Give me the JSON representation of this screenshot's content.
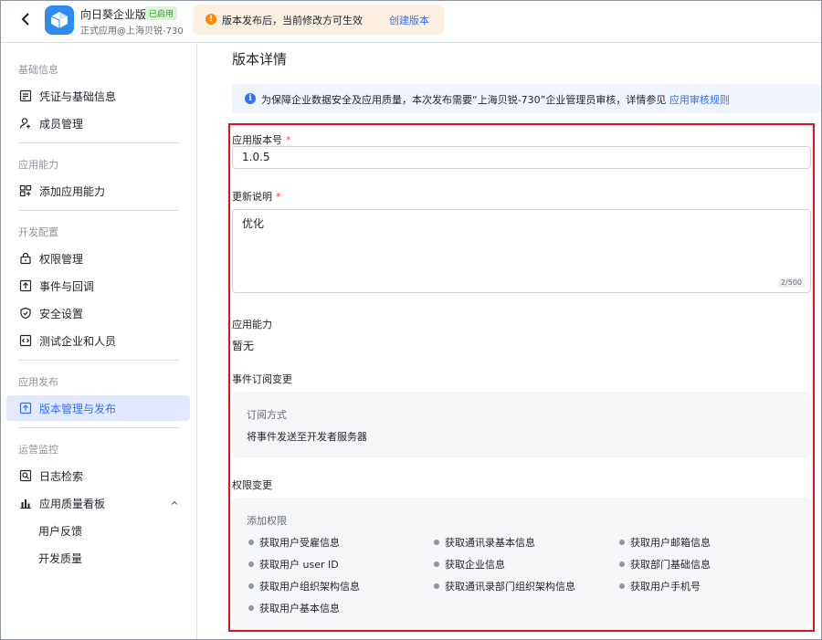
{
  "header": {
    "app_name": "向日葵企业版",
    "status_badge": "已启用",
    "app_subtitle": "正式应用@上海贝锐-730",
    "notice_text": "版本发布后，当前修改方可生效",
    "notice_link": "创建版本"
  },
  "sidebar": {
    "sections": [
      {
        "title": "基础信息",
        "items": [
          {
            "label": "凭证与基础信息",
            "icon": "document-icon"
          },
          {
            "label": "成员管理",
            "icon": "user-add-icon"
          }
        ]
      },
      {
        "title": "应用能力",
        "items": [
          {
            "label": "添加应用能力",
            "icon": "grid-add-icon"
          }
        ]
      },
      {
        "title": "开发配置",
        "items": [
          {
            "label": "权限管理",
            "icon": "lock-icon"
          },
          {
            "label": "事件与回调",
            "icon": "event-icon"
          },
          {
            "label": "安全设置",
            "icon": "shield-icon"
          },
          {
            "label": "测试企业和人员",
            "icon": "code-icon"
          }
        ]
      },
      {
        "title": "应用发布",
        "items": [
          {
            "label": "版本管理与发布",
            "icon": "upload-icon",
            "active": true
          }
        ]
      },
      {
        "title": "运营监控",
        "items": [
          {
            "label": "日志检索",
            "icon": "search-log-icon"
          },
          {
            "label": "应用质量看板",
            "icon": "bar-chart-icon"
          },
          {
            "label": "用户反馈"
          },
          {
            "label": "开发质量"
          }
        ]
      }
    ]
  },
  "main": {
    "title": "版本详情",
    "info_text": "为保障企业数据安全及应用质量，本次发布需要“上海贝锐-730”企业管理员审核，详情参见",
    "info_link": "应用审核规则",
    "version_label": "应用版本号",
    "version_value": "1.0.5",
    "desc_label": "更新说明",
    "desc_value": "优化",
    "desc_counter": "2/500",
    "capability_label": "应用能力",
    "capability_value": "暂无",
    "event_label": "事件订阅变更",
    "event_panel_title": "订阅方式",
    "event_panel_value": "将事件发送至开发者服务器",
    "perm_label": "权限变更",
    "perm_panel_title": "添加权限",
    "permissions": [
      "获取用户受雇信息",
      "获取通讯录基本信息",
      "获取用户邮箱信息",
      "获取用户 user ID",
      "获取企业信息",
      "获取部门基础信息",
      "获取用户组织架构信息",
      "获取通讯录部门组织架构信息",
      "获取用户手机号",
      "获取用户基本信息"
    ]
  },
  "colors": {
    "accent": "#3370ff",
    "highlight_border": "#e0101f",
    "active_bg": "#e1eaff"
  }
}
